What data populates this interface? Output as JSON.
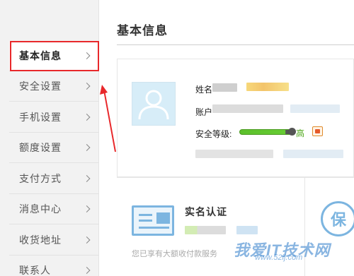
{
  "sidebar": {
    "items": [
      {
        "label": "基本信息",
        "active": true
      },
      {
        "label": "安全设置",
        "active": false
      },
      {
        "label": "手机设置",
        "active": false
      },
      {
        "label": "额度设置",
        "active": false
      },
      {
        "label": "支付方式",
        "active": false
      },
      {
        "label": "消息中心",
        "active": false
      },
      {
        "label": "收货地址",
        "active": false
      },
      {
        "label": "联系人",
        "active": false
      }
    ]
  },
  "main": {
    "page_title": "基本信息",
    "profile": {
      "name_label": "姓名",
      "account_label": "账户",
      "security_label": "安全等级:",
      "security_level": "高",
      "security_progress": 0.9
    },
    "cards": {
      "realname": {
        "title": "实名认证",
        "note": "您已享有大额收付款服务"
      },
      "insurance_icon": "保"
    }
  },
  "watermark": {
    "text": "我爱IT技术网",
    "url": "www.52ij.com"
  },
  "colors": {
    "highlight_red": "#e8282b",
    "security_green": "#66cc33",
    "icon_blue": "#7cb5e0"
  }
}
